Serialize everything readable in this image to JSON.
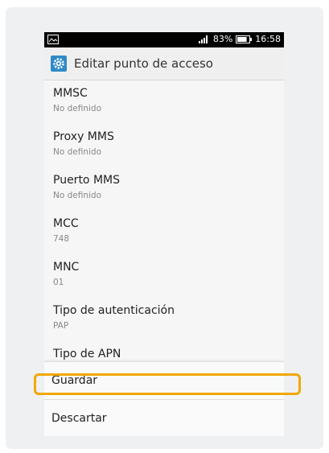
{
  "status_bar": {
    "battery_percent": "83%",
    "time": "16:58",
    "battery_level": 0.83
  },
  "action_bar": {
    "title": "Editar punto de acceso",
    "icon": "settings-gear-icon"
  },
  "settings": [
    {
      "label": "MMSC",
      "value": "No definido"
    },
    {
      "label": "Proxy MMS",
      "value": "No definido"
    },
    {
      "label": "Puerto MMS",
      "value": "No definido"
    },
    {
      "label": "MCC",
      "value": "748"
    },
    {
      "label": "MNC",
      "value": "01"
    },
    {
      "label": "Tipo de autenticación",
      "value": "PAP"
    },
    {
      "label": "Tipo de APN",
      "value": ""
    }
  ],
  "menu": {
    "save_label": "Guardar",
    "discard_label": "Descartar"
  },
  "colors": {
    "highlight": "#f0a800",
    "app_icon": "#2f8ac6"
  }
}
